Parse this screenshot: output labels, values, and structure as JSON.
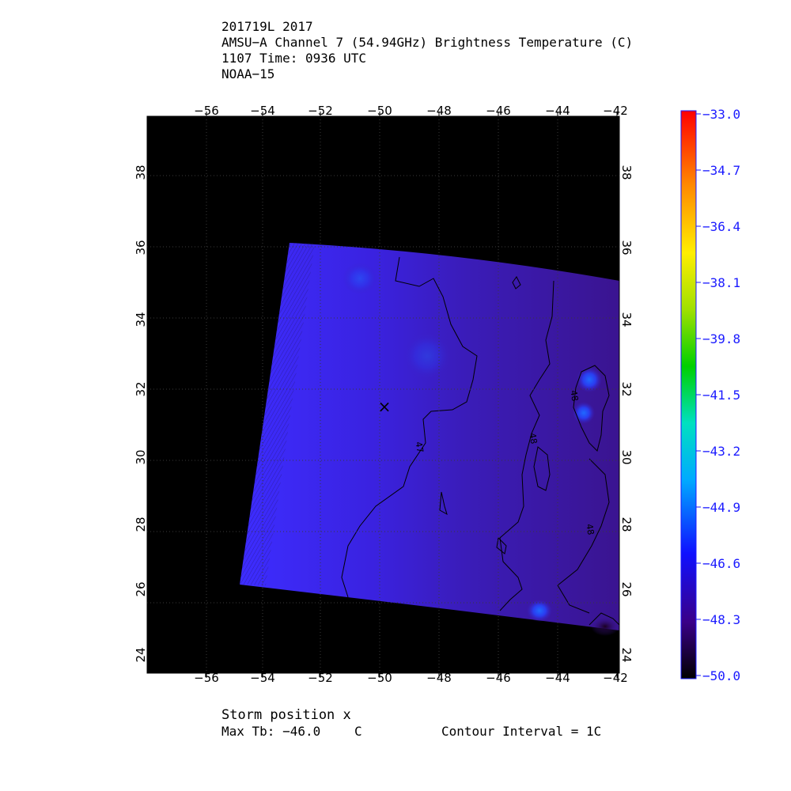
{
  "header": {
    "line1": "201719L 2017",
    "line2": "AMSU−A Channel 7 (54.94GHz) Brightness Temperature (C)",
    "line3": "1107 Time: 0936 UTC",
    "line4": "NOAA−15"
  },
  "map": {
    "lon_ticks": [
      "−56",
      "−54",
      "−52",
      "−50",
      "−48",
      "−46",
      "−44",
      "−42"
    ],
    "lat_ticks": [
      "24",
      "26",
      "28",
      "30",
      "32",
      "34",
      "36",
      "38"
    ],
    "lon_range": [
      -58,
      -42
    ],
    "lat_range": [
      23.5,
      39.5
    ],
    "storm_marker": "×",
    "storm_position": {
      "lon": -50,
      "lat": 31.5
    },
    "contour_labels": [
      "47",
      "48",
      "48",
      "48"
    ],
    "colors": {
      "background": "#000000",
      "swath_blue": "#3a22e0",
      "swath_purple": "#3d1a9e"
    }
  },
  "colorbar": {
    "labels": [
      "−33.0",
      "−34.7",
      "−36.4",
      "−38.1",
      "−39.8",
      "−41.5",
      "−43.2",
      "−44.9",
      "−46.6",
      "−48.3",
      "−50.0"
    ],
    "label_color": "#1a1aff"
  },
  "footer": {
    "storm_label": "Storm position x",
    "max_tb": "Max Tb: −46.0",
    "max_tb_unit": "C",
    "contour_interval": "Contour Interval = 1C"
  }
}
